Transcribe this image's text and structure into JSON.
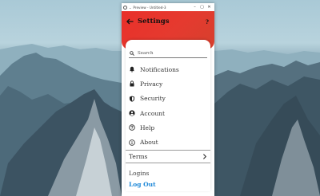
{
  "window": {
    "title": "Preview - Untitled-3"
  },
  "appbar": {
    "title": "Settings",
    "help_label": "?",
    "color": "#e9302a"
  },
  "search": {
    "placeholder": "Search"
  },
  "menu": [
    {
      "label": "Notifications",
      "icon": "bell-icon"
    },
    {
      "label": "Privacy",
      "icon": "lock-icon"
    },
    {
      "label": "Security",
      "icon": "shield-icon"
    },
    {
      "label": "Account",
      "icon": "account-icon"
    },
    {
      "label": "Help",
      "icon": "help-icon"
    },
    {
      "label": "About",
      "icon": "info-icon"
    }
  ],
  "terms": {
    "label": "Terms"
  },
  "footer": {
    "logins": "Logins",
    "logout": "Log Out",
    "logout_color": "#1e88d8"
  }
}
